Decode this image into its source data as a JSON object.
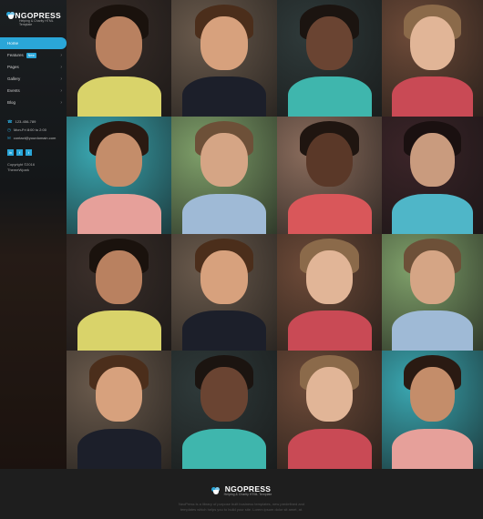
{
  "brand": {
    "name": "NGOPRESS",
    "tagline": "Helping & Charity HTML Template"
  },
  "nav": [
    {
      "label": "Home",
      "active": true
    },
    {
      "label": "Features",
      "badge": "New"
    },
    {
      "label": "Pages"
    },
    {
      "label": "Gallery"
    },
    {
      "label": "Events"
    },
    {
      "label": "Blog"
    }
  ],
  "contact": {
    "phone": "123-456-789",
    "hours": "Mon-Fri 8:00 to 2:00",
    "email": "contact@yourdomain.com"
  },
  "social": [
    "in",
    "f",
    "t"
  ],
  "copyright": [
    "Copyright ©2016",
    "ThemeWpark"
  ],
  "footer": {
    "name": "NGOPRESS",
    "tagline": "Helping & Charity HTML Template",
    "text": "NeoPress is a library of purpose built business templates, new predefined and templates which helps you to build your site. Lorem ipsum dolor sit amet, at."
  },
  "colors": {
    "accent": "#2aa6d8",
    "footer_bg": "#1e1e1e"
  },
  "gallery": [
    {
      "bg": "#3b2f2a",
      "skin": "#b98160",
      "hair": "#1a120d",
      "shirt": "#d9d36a"
    },
    {
      "bg": "#6a5a4c",
      "skin": "#d7a17d",
      "hair": "#4b2e1b",
      "shirt": "#1c1f2a"
    },
    {
      "bg": "#2f3a3a",
      "skin": "#6a4432",
      "hair": "#1b1410",
      "shirt": "#3fb6ad"
    },
    {
      "bg": "#6d4a38",
      "skin": "#e1b597",
      "hair": "#8b6a4a",
      "shirt": "#c94a55"
    },
    {
      "bg": "#3aa7b1",
      "skin": "#c48d6a",
      "hair": "#2a1a12",
      "shirt": "#e6a09a"
    },
    {
      "bg": "#7fa06a",
      "skin": "#d5a585",
      "hair": "#6d5038",
      "shirt": "#9fbad6"
    },
    {
      "bg": "#8a6c5c",
      "skin": "#5a3828",
      "hair": "#1f1510",
      "shirt": "#d9575a"
    },
    {
      "bg": "#3b2428",
      "skin": "#c99b7e",
      "hair": "#1a1010",
      "shirt": "#4fb6c8"
    },
    {
      "bg": "#3b2f2a",
      "skin": "#b98160",
      "hair": "#1a120d",
      "shirt": "#d9d36a"
    },
    {
      "bg": "#6a5a4c",
      "skin": "#d7a17d",
      "hair": "#4b2e1b",
      "shirt": "#1c1f2a"
    },
    {
      "bg": "#6d4a38",
      "skin": "#e1b597",
      "hair": "#8b6a4a",
      "shirt": "#c94a55"
    },
    {
      "bg": "#7fa06a",
      "skin": "#d5a585",
      "hair": "#6d5038",
      "shirt": "#9fbad6"
    },
    {
      "bg": "#6a5a4c",
      "skin": "#d7a17d",
      "hair": "#4b2e1b",
      "shirt": "#1c1f2a"
    },
    {
      "bg": "#2f3a3a",
      "skin": "#6a4432",
      "hair": "#1b1410",
      "shirt": "#3fb6ad"
    },
    {
      "bg": "#6d4a38",
      "skin": "#e1b597",
      "hair": "#8b6a4a",
      "shirt": "#c94a55"
    },
    {
      "bg": "#3aa7b1",
      "skin": "#c48d6a",
      "hair": "#2a1a12",
      "shirt": "#e6a09a"
    }
  ]
}
